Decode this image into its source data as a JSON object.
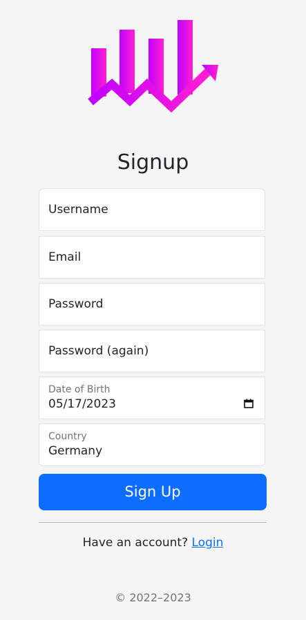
{
  "logo": {
    "icon": "bar-chart-growth-icon",
    "gradient_start": "#c000ff",
    "gradient_end": "#ff1fd2"
  },
  "title": "Signup",
  "fields": {
    "username_placeholder": "Username",
    "email_placeholder": "Email",
    "password_placeholder": "Password",
    "password_again_placeholder": "Password (again)",
    "dob_label": "Date of Birth",
    "dob_value": "05/17/2023",
    "country_label": "Country",
    "country_value": "Germany"
  },
  "signup_button": "Sign Up",
  "account": {
    "prompt": "Have an account?",
    "login_link": "Login"
  },
  "copyright": "© 2022–2023",
  "colors": {
    "primary": "#0d6efd",
    "background": "#f5f5f5"
  }
}
